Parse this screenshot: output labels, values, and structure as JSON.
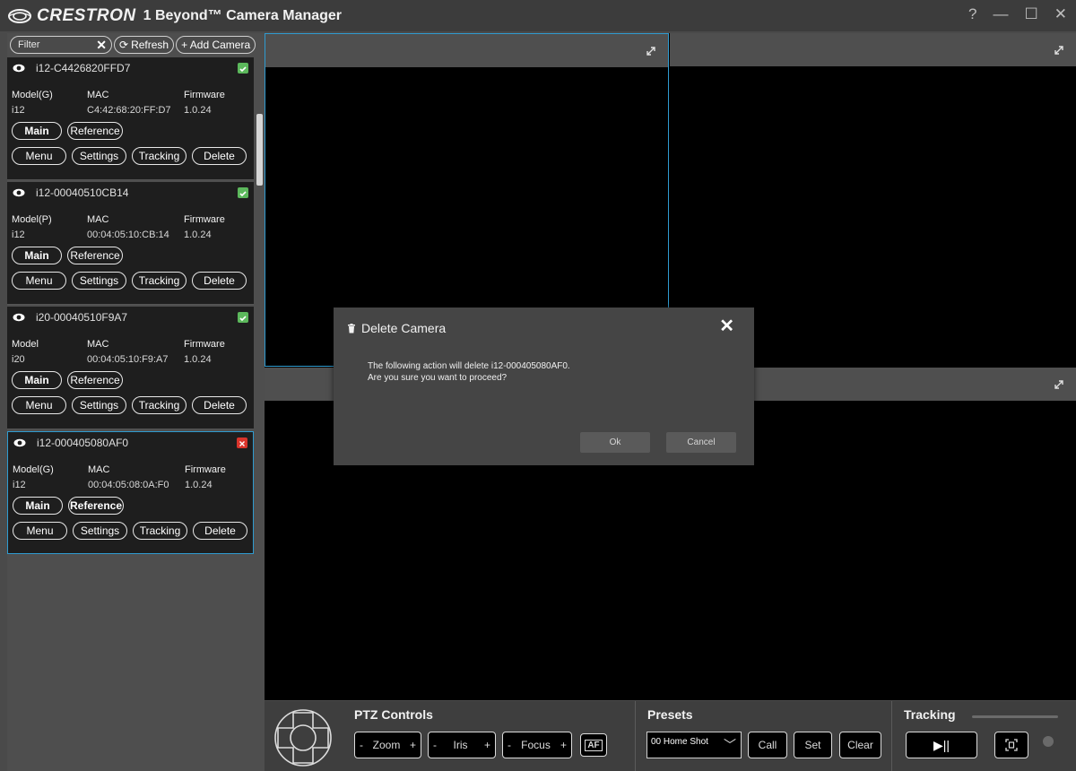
{
  "titlebar": {
    "brand": "CRESTRON",
    "app_title": "1 Beyond™ Camera Manager",
    "help_label": "?",
    "minimize_label": "—",
    "maximize_label": "☐",
    "close_label": "✕"
  },
  "sidebar": {
    "filter_placeholder": "Filter",
    "clear_label": "✕",
    "refresh_label": "Refresh",
    "add_camera_label": "+ Add Camera"
  },
  "camera_labels": {
    "mac": "MAC",
    "firmware": "Firmware",
    "main": "Main",
    "reference": "Reference",
    "menu": "Menu",
    "settings": "Settings",
    "tracking": "Tracking",
    "delete": "Delete"
  },
  "cameras": [
    {
      "name": "i12-C4426820FFD7",
      "model_label": "Model(G)",
      "model": "i12",
      "mac": "C4:42:68:20:FF:D7",
      "firmware": "1.0.24",
      "status": "ok"
    },
    {
      "name": "i12-00040510CB14",
      "model_label": "Model(P)",
      "model": "i12",
      "mac": "00:04:05:10:CB:14",
      "firmware": "1.0.24",
      "status": "ok"
    },
    {
      "name": "i20-00040510F9A7",
      "model_label": "Model",
      "model": "i20",
      "mac": "00:04:05:10:F9:A7",
      "firmware": "1.0.24",
      "status": "ok"
    },
    {
      "name": "i12-000405080AF0",
      "model_label": "Model(G)",
      "model": "i12",
      "mac": "00:04:05:08:0A:F0",
      "firmware": "1.0.24",
      "status": "error",
      "selected": true
    }
  ],
  "controls": {
    "ptz_title": "PTZ Controls",
    "zoom_label": "Zoom",
    "iris_label": "Iris",
    "focus_label": "Focus",
    "minus": "-",
    "plus": "+",
    "af_label": "AF",
    "presets_title": "Presets",
    "preset_selected": "00 Home Shot",
    "call_label": "Call",
    "set_label": "Set",
    "clear_label": "Clear",
    "tracking_title": "Tracking",
    "play_pause_label": "▶||"
  },
  "dialog": {
    "title": "Delete Camera",
    "close_label": "✕",
    "message_line1": "The following action will delete i12-000405080AF0.",
    "message_line2": "Are you sure you want to proceed?",
    "ok_label": "Ok",
    "cancel_label": "Cancel"
  },
  "colors": {
    "accent_blue": "#2f9bd0",
    "status_ok": "#5cb85c",
    "status_error": "#d9342b"
  }
}
